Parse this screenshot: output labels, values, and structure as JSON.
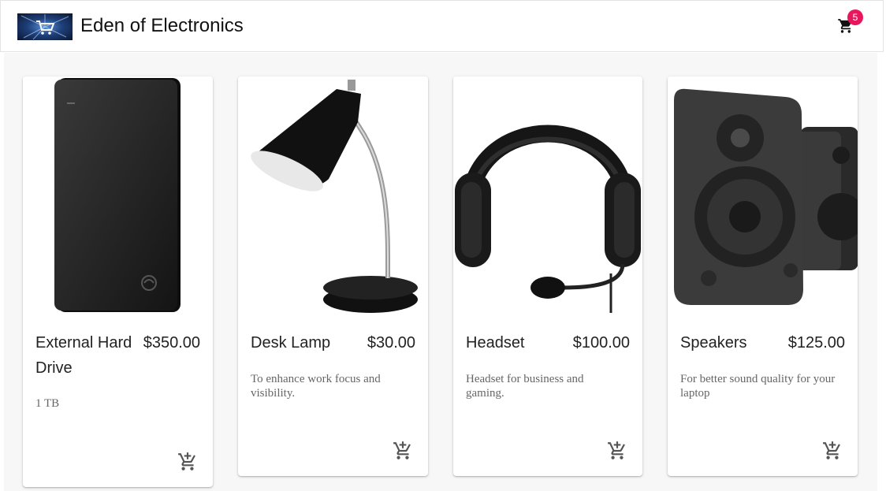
{
  "header": {
    "brand": "Eden of Electronics",
    "cart_count": "5"
  },
  "products": [
    {
      "name": "External Hard Drive",
      "price": "$350.00",
      "description": "1 TB"
    },
    {
      "name": "Desk Lamp",
      "price": "$30.00",
      "description": "To enhance work focus and visibility."
    },
    {
      "name": "Headset",
      "price": "$100.00",
      "description": "Headset for business and gaming."
    },
    {
      "name": "Speakers",
      "price": "$125.00",
      "description": "For better sound quality for your laptop"
    }
  ],
  "icons": {
    "logo": "shopping-cart-logo",
    "cart": "shopping-cart-icon",
    "add_to_cart": "add-shopping-cart-icon"
  },
  "colors": {
    "badge": "#e8175d",
    "text": "#222222",
    "description": "#666666",
    "background": "#f7f7f7"
  }
}
